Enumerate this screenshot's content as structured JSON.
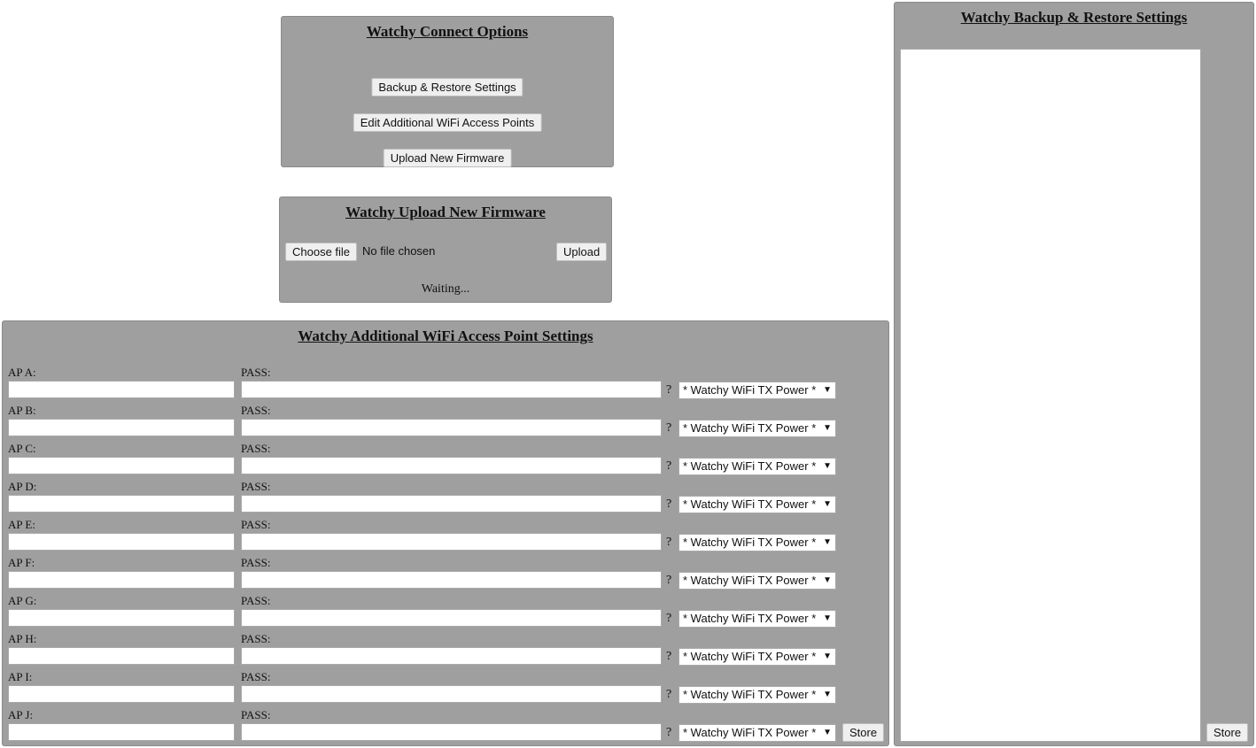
{
  "connect": {
    "title": "Watchy Connect Options",
    "backup_label": "Backup & Restore Settings",
    "edit_ap_label": "Edit Additional WiFi Access Points",
    "upload_fw_label": "Upload New Firmware"
  },
  "upload": {
    "title": "Watchy Upload New Firmware",
    "choose_label": "Choose file",
    "file_status": "No file chosen",
    "upload_label": "Upload",
    "status": "Waiting..."
  },
  "wifi": {
    "title": "Watchy Additional WiFi Access Point Settings",
    "pass_label": "PASS:",
    "help_mark": "?",
    "tx_power_selected": "* Watchy WiFi TX Power *",
    "store_label": "Store",
    "access_points": [
      {
        "label": "AP A:",
        "ssid": "",
        "pass": ""
      },
      {
        "label": "AP B:",
        "ssid": "",
        "pass": ""
      },
      {
        "label": "AP C:",
        "ssid": "",
        "pass": ""
      },
      {
        "label": "AP D:",
        "ssid": "",
        "pass": ""
      },
      {
        "label": "AP E:",
        "ssid": "",
        "pass": ""
      },
      {
        "label": "AP F:",
        "ssid": "",
        "pass": ""
      },
      {
        "label": "AP G:",
        "ssid": "",
        "pass": ""
      },
      {
        "label": "AP H:",
        "ssid": "",
        "pass": ""
      },
      {
        "label": "AP I:",
        "ssid": "",
        "pass": ""
      },
      {
        "label": "AP J:",
        "ssid": "",
        "pass": ""
      }
    ]
  },
  "backup": {
    "title": "Watchy Backup & Restore Settings",
    "content": "",
    "store_label": "Store"
  },
  "icons": {
    "dropdown": "chevron-down-icon"
  }
}
